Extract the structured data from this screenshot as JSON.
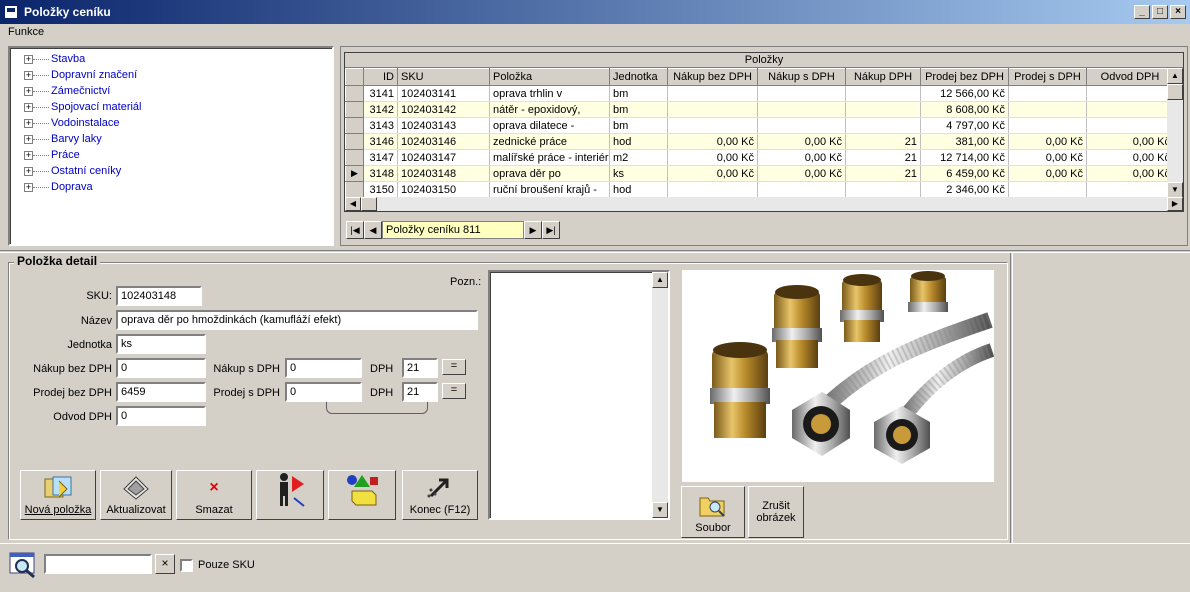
{
  "window": {
    "title": "Položky ceníku"
  },
  "menu": {
    "funkce": "Funkce"
  },
  "tree": {
    "items": [
      "Stavba",
      "Dopravní značení",
      "Zámečnictví",
      "Spojovací materiál",
      "Vodoinstalace",
      "Barvy laky",
      "Práce",
      "Ostatní ceníky",
      "Doprava"
    ]
  },
  "grid": {
    "caption": "Položky",
    "columns": [
      "ID",
      "SKU",
      "Položka",
      "Jednotka",
      "Nákup bez DPH",
      "Nákup s DPH",
      "Nákup DPH",
      "Prodej bez DPH",
      "Prodej s DPH",
      "Odvod DPH"
    ],
    "rows": [
      {
        "id": "3141",
        "sku": "102403141",
        "name": "oprava trhlin v",
        "unit": "bm",
        "nbez": "",
        "ns": "",
        "ndph": "",
        "pbez": "12 566,00 Kč",
        "ps": "",
        "odvod": ""
      },
      {
        "id": "3142",
        "sku": "102403142",
        "name": "nátěr - epoxidový,",
        "unit": "bm",
        "nbez": "",
        "ns": "",
        "ndph": "",
        "pbez": "8 608,00 Kč",
        "ps": "",
        "odvod": ""
      },
      {
        "id": "3143",
        "sku": "102403143",
        "name": "oprava dilatece -",
        "unit": "bm",
        "nbez": "",
        "ns": "",
        "ndph": "",
        "pbez": "4 797,00 Kč",
        "ps": "",
        "odvod": ""
      },
      {
        "id": "3146",
        "sku": "102403146",
        "name": "zednické práce",
        "unit": "hod",
        "nbez": "0,00 Kč",
        "ns": "0,00 Kč",
        "ndph": "21",
        "pbez": "381,00 Kč",
        "ps": "0,00 Kč",
        "odvod": "0,00 Kč"
      },
      {
        "id": "3147",
        "sku": "102403147",
        "name": "malířské práce - interiér",
        "unit": "m2",
        "nbez": "0,00 Kč",
        "ns": "0,00 Kč",
        "ndph": "21",
        "pbez": "12 714,00 Kč",
        "ps": "0,00 Kč",
        "odvod": "0,00 Kč"
      },
      {
        "id": "3148",
        "sku": "102403148",
        "name": "oprava děr po",
        "unit": "ks",
        "nbez": "0,00 Kč",
        "ns": "0,00 Kč",
        "ndph": "21",
        "pbez": "6 459,00 Kč",
        "ps": "0,00 Kč",
        "odvod": "0,00 Kč"
      },
      {
        "id": "3150",
        "sku": "102403150",
        "name": "ruční broušení krajů -",
        "unit": "hod",
        "nbez": "",
        "ns": "",
        "ndph": "",
        "pbez": "2 346,00 Kč",
        "ps": "",
        "odvod": ""
      }
    ]
  },
  "navigator": {
    "label": "Položky ceníku 811"
  },
  "detail": {
    "title": "Položka detail",
    "sku_label": "SKU:",
    "sku": "102403148",
    "name_label": "Název",
    "name": "oprava děr po hmoždinkách (kamufláží efekt)",
    "unit_label": "Jednotka",
    "unit": "ks",
    "nakup_bez_label": "Nákup bez DPH",
    "nakup_bez": "0",
    "nakup_s_label": "Nákup s DPH",
    "nakup_s": "0",
    "dph_label": "DPH",
    "dph1": "21",
    "dph2": "21",
    "prodej_bez_label": "Prodej bez DPH",
    "prodej_bez": "6459",
    "prodej_s_label": "Prodej s DPH",
    "prodej_s": "0",
    "odvod_label": "Odvod DPH",
    "odvod": "0",
    "eq": "=",
    "pozn_label": "Pozn.:"
  },
  "buttons": {
    "nova": "Nová položka",
    "aktualizovat": "Aktualizovat",
    "smazat": "Smazat",
    "konec": "Konec  (F12)",
    "soubor": "Soubor",
    "zrusit1": "Zrušit",
    "zrusit2": "obrázek"
  },
  "search": {
    "value": "",
    "clear": "×",
    "pouze_sku": "Pouze SKU"
  }
}
